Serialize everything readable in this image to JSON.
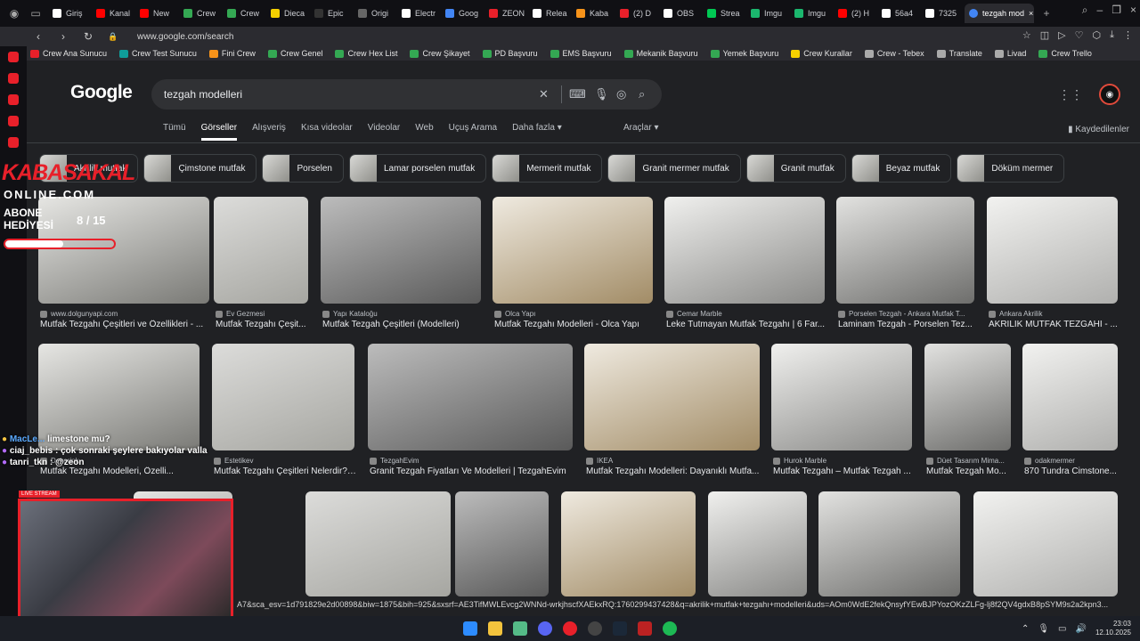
{
  "tabs": [
    {
      "label": "Giriş",
      "color": "#ffffff"
    },
    {
      "label": "Kanal",
      "color": "#ff0000"
    },
    {
      "label": "New",
      "color": "#ff0000"
    },
    {
      "label": "Crew",
      "color": "#34a853"
    },
    {
      "label": "Crew",
      "color": "#34a853"
    },
    {
      "label": "Dieca",
      "color": "#f5d000"
    },
    {
      "label": "Epic",
      "color": "#333333"
    },
    {
      "label": "Origi",
      "color": "#666666"
    },
    {
      "label": "Electr",
      "color": "#ffffff"
    },
    {
      "label": "Goog",
      "color": "#4285f4"
    },
    {
      "label": "ZEON",
      "color": "#e8202a"
    },
    {
      "label": "Relea",
      "color": "#ffffff"
    },
    {
      "label": "Kaba",
      "color": "#f7931a"
    },
    {
      "label": "(2) D",
      "color": "#e8202a"
    },
    {
      "label": "OBS",
      "color": "#ffffff"
    },
    {
      "label": "Strea",
      "color": "#00c853"
    },
    {
      "label": "Imgu",
      "color": "#1bb76e"
    },
    {
      "label": "Imgu",
      "color": "#1bb76e"
    },
    {
      "label": "(2) H",
      "color": "#ff0000"
    },
    {
      "label": "56a4",
      "color": "#ffffff"
    },
    {
      "label": "7325",
      "color": "#ffffff"
    }
  ],
  "active_tab": {
    "label": "tezgah mod",
    "color": "#4285f4"
  },
  "address": {
    "url": "www.google.com/search"
  },
  "bookmarks": [
    {
      "label": "Crew Ana Sunucu",
      "color": "#e8202a"
    },
    {
      "label": "Crew Test Sunucu",
      "color": "#0f9d9a"
    },
    {
      "label": "Fini Crew",
      "color": "#f7931a"
    },
    {
      "label": "Crew Genel",
      "color": "#34a853"
    },
    {
      "label": "Crew Hex List",
      "color": "#34a853"
    },
    {
      "label": "Crew Şikayet",
      "color": "#34a853"
    },
    {
      "label": "PD Başvuru",
      "color": "#34a853"
    },
    {
      "label": "EMS Başvuru",
      "color": "#34a853"
    },
    {
      "label": "Mekanik Başvuru",
      "color": "#34a853"
    },
    {
      "label": "Yemek Başvuru",
      "color": "#34a853"
    },
    {
      "label": "Crew Kurallar",
      "color": "#f5d000"
    },
    {
      "label": "Crew - Tebex",
      "color": "#aaaaaa"
    },
    {
      "label": "Translate",
      "color": "#aaaaaa"
    },
    {
      "label": "Livad",
      "color": "#aaaaaa"
    },
    {
      "label": "Crew Trello",
      "color": "#34a853"
    }
  ],
  "google": {
    "logo": "Google",
    "query": "tezgah modelleri",
    "nav": [
      "Tümü",
      "Görseller",
      "Alışveriş",
      "Kısa videolar",
      "Videolar",
      "Web",
      "Uçuş Arama",
      "Daha fazla ▾"
    ],
    "active_nav": "Görseller",
    "tools": "Araçlar ▾",
    "saved": "Kaydedilenler"
  },
  "chips": [
    "Akrilik mutfak",
    "Çimstone mutfak",
    "Porselen",
    "Lamar porselen mutfak",
    "Mermerit mutfak",
    "Granit mermer mutfak",
    "Granit mutfak",
    "Beyaz mutfak",
    "Döküm mermer"
  ],
  "results_row1": [
    {
      "source": "www.dolgunyapi.com",
      "title": "Mutfak Tezgahı Çeşitleri ve Özellikleri - ..."
    },
    {
      "source": "Ev Gezmesi",
      "title": "Mutfak Tezgahı Çeşit..."
    },
    {
      "source": "Yapı Kataloğu",
      "title": "Mutfak Tezgah Çeşitleri (Modelleri)"
    },
    {
      "source": "Olca Yapı",
      "title": "Mutfak Tezgahı Modelleri - Olca Yapı"
    },
    {
      "source": "Cemar Marble",
      "title": "Leke Tutmayan Mutfak Tezgahı | 6 Far..."
    },
    {
      "source": "Porselen Tezgah - Ankara Mutfak T...",
      "title": "Laminam Tezgah - Porselen Tez..."
    },
    {
      "source": "Ankara Akrilik",
      "title": "AKRİLİK MUTFAK TEZGAHI - ..."
    }
  ],
  "results_row2": [
    {
      "source": "Dekorink",
      "title": "Mutfak Tezgahı Modelleri, Özelli..."
    },
    {
      "source": "Estetikev",
      "title": "Mutfak Tezgahı Çeşitleri Nelerdir? ..."
    },
    {
      "source": "TezgahEvim",
      "title": "Granit Tezgah Fiyatları Ve Modelleri | TezgahEvim"
    },
    {
      "source": "IKEA",
      "title": "Mutfak Tezgahı Modelleri: Dayanıklı Mutfa..."
    },
    {
      "source": "Hurok Marble",
      "title": "Mutfak Tezgahı – Mutfak Tezgah ..."
    },
    {
      "source": "Düet Tasarım Mima...",
      "title": "Mutfak Tezgah Mo..."
    },
    {
      "source": "odakmermer",
      "title": "870 Tundra Cimstone..."
    }
  ],
  "status_url": "A7&sca_esv=1d791829e2d00898&biw=1875&bih=925&sxsrf=AE3TifMWLEvcg2WNNd-wrkjhscfXAEkxRQ:1760299437428&q=akrilik+mutfak+tezgahı+modelleri&uds=AOm0WdE2fekQnsyfYEwBJPYozOKzZLFg-lj8f2QV4gdxB8pSYM9s2a2kpn3...",
  "overlay": {
    "brand": "KABASAKAL",
    "brand_sub": "ONLINE.COM",
    "gift_label_1": "ABONE",
    "gift_label_2": "HEDİYESİ",
    "gift_count": "8 / 15",
    "gift_progress": 0.53,
    "cam_label": "LIVE STREAM"
  },
  "chat": [
    {
      "user": "MacLe...",
      "msg": "limestone mu?"
    },
    {
      "user": "ciaj_bebis",
      "msg": ": çok sonraki şeylere bakıyolar valla"
    },
    {
      "user": "tanri_tkn",
      "msg": ": @zeon"
    }
  ],
  "taskbar": {
    "time": "23:03",
    "date": "12.10.2025"
  }
}
